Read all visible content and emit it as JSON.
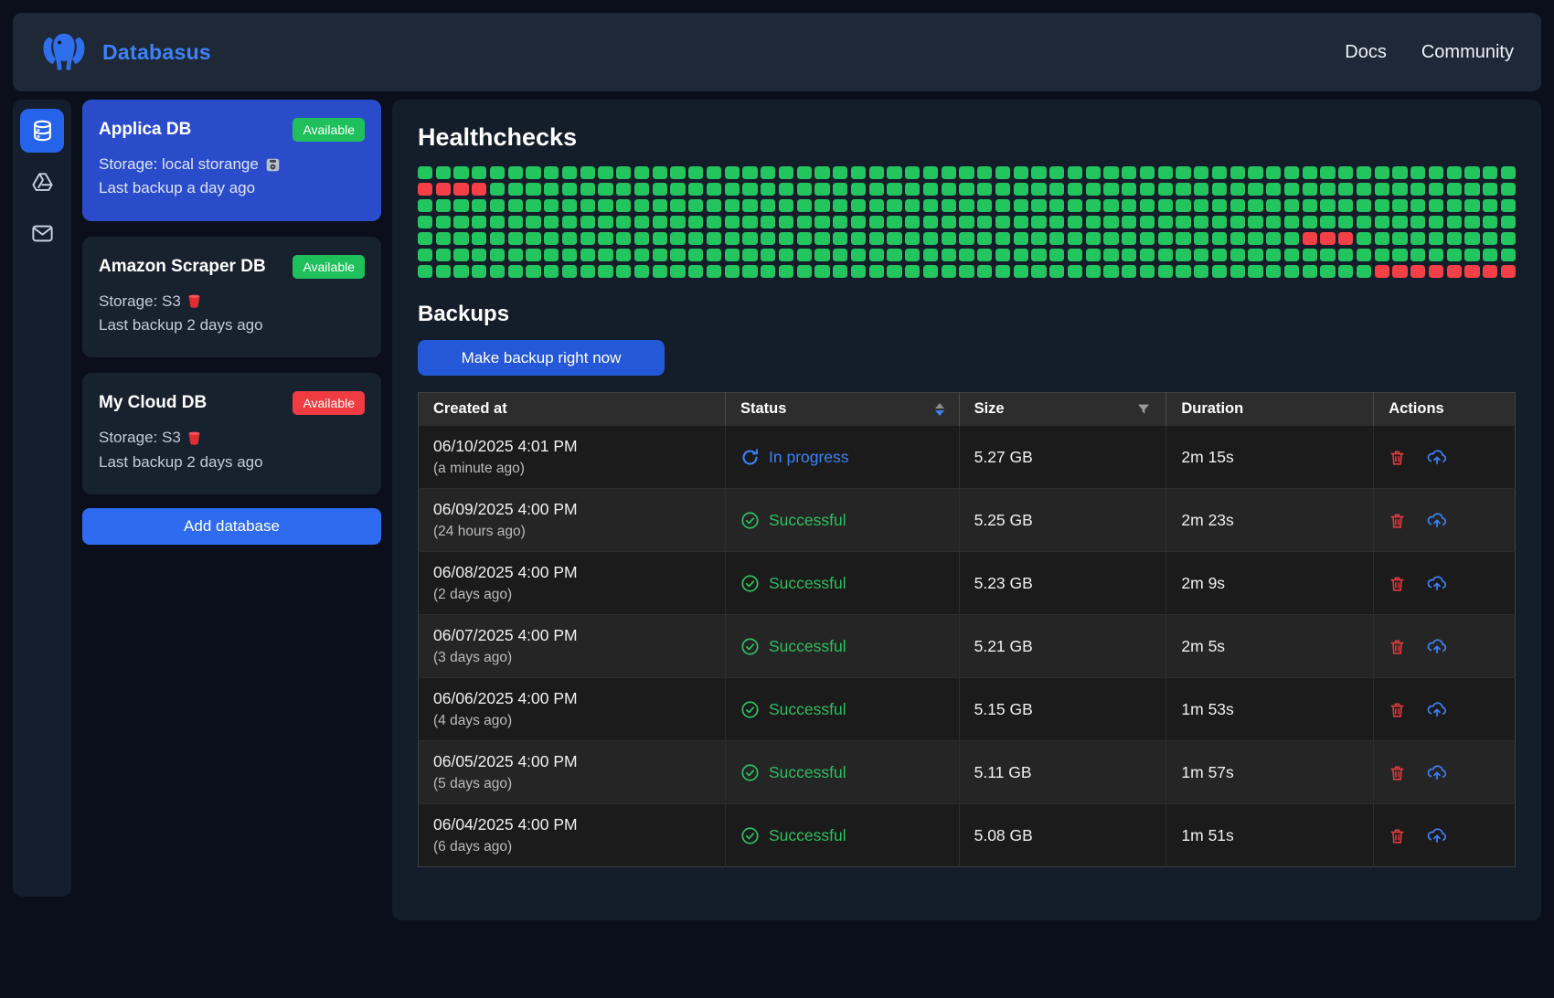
{
  "brand": {
    "name": "Databasus"
  },
  "nav": {
    "links": [
      "Docs",
      "Community"
    ]
  },
  "sidebar": {
    "items": [
      {
        "icon": "database-icon",
        "active": true
      },
      {
        "icon": "drive-icon",
        "active": false
      },
      {
        "icon": "mail-icon",
        "active": false
      }
    ]
  },
  "databases": [
    {
      "name": "Applica DB",
      "badge": "Available",
      "badge_color": "#1fc05b",
      "storage_label": "Storage: local storange",
      "storage_icon": "hard-drive-icon",
      "last_backup": "Last backup a day ago",
      "selected": true
    },
    {
      "name": "Amazon Scraper DB",
      "badge": "Available",
      "badge_color": "#1fc05b",
      "storage_label": "Storage: S3",
      "storage_icon": "s3-icon",
      "last_backup": "Last backup 2 days ago",
      "selected": false
    },
    {
      "name": "My Cloud DB",
      "badge": "Available",
      "badge_color": "#ef3b41",
      "storage_label": "Storage: S3",
      "storage_icon": "s3-icon",
      "last_backup": "Last backup 2 days ago",
      "selected": false
    }
  ],
  "add_database_label": "Add database",
  "healthchecks": {
    "title": "Healthchecks",
    "rows": 7,
    "cols": 61,
    "green_color": "#22c55e",
    "red_color": "#f43f46",
    "red_cells": [
      [
        2,
        1
      ],
      [
        2,
        2
      ],
      [
        2,
        3
      ],
      [
        2,
        4
      ],
      [
        5,
        50
      ],
      [
        5,
        51
      ],
      [
        5,
        52
      ],
      [
        7,
        54
      ],
      [
        7,
        55
      ],
      [
        7,
        56
      ],
      [
        7,
        57
      ],
      [
        7,
        58
      ],
      [
        7,
        59
      ],
      [
        7,
        60
      ],
      [
        7,
        61
      ]
    ]
  },
  "backups": {
    "title": "Backups",
    "button_label": "Make backup right now"
  },
  "table": {
    "columns": [
      "Created at",
      "Status",
      "Size",
      "Duration",
      "Actions"
    ],
    "sort_column": "Status",
    "filter_column": "Size",
    "rows": [
      {
        "created_at": "06/10/2025 4:01 PM",
        "ago": "(a minute ago)",
        "status": "In progress",
        "status_type": "progress",
        "size": "5.27 GB",
        "duration": "2m 15s"
      },
      {
        "created_at": "06/09/2025 4:00 PM",
        "ago": "(24 hours ago)",
        "status": "Successful",
        "status_type": "success",
        "size": "5.25 GB",
        "duration": "2m 23s"
      },
      {
        "created_at": "06/08/2025 4:00 PM",
        "ago": "(2 days ago)",
        "status": "Successful",
        "status_type": "success",
        "size": "5.23 GB",
        "duration": "2m 9s"
      },
      {
        "created_at": "06/07/2025 4:00 PM",
        "ago": "(3 days ago)",
        "status": "Successful",
        "status_type": "success",
        "size": "5.21 GB",
        "duration": "2m 5s"
      },
      {
        "created_at": "06/06/2025 4:00 PM",
        "ago": "(4 days ago)",
        "status": "Successful",
        "status_type": "success",
        "size": "5.15 GB",
        "duration": "1m 53s"
      },
      {
        "created_at": "06/05/2025 4:00 PM",
        "ago": "(5 days ago)",
        "status": "Successful",
        "status_type": "success",
        "size": "5.11 GB",
        "duration": "1m 57s"
      },
      {
        "created_at": "06/04/2025 4:00 PM",
        "ago": "(6 days ago)",
        "status": "Successful",
        "status_type": "success",
        "size": "5.08 GB",
        "duration": "1m 51s"
      }
    ]
  },
  "colors": {
    "accent_blue": "#2e6bf0",
    "brand_blue": "#3d82f6",
    "selected_card_blue": "#2a4ccb",
    "status_progress": "#3b82f6",
    "status_success": "#2dbf5e",
    "action_trash_red": "#e23b3f",
    "action_cloud_blue": "#3b82f6"
  }
}
